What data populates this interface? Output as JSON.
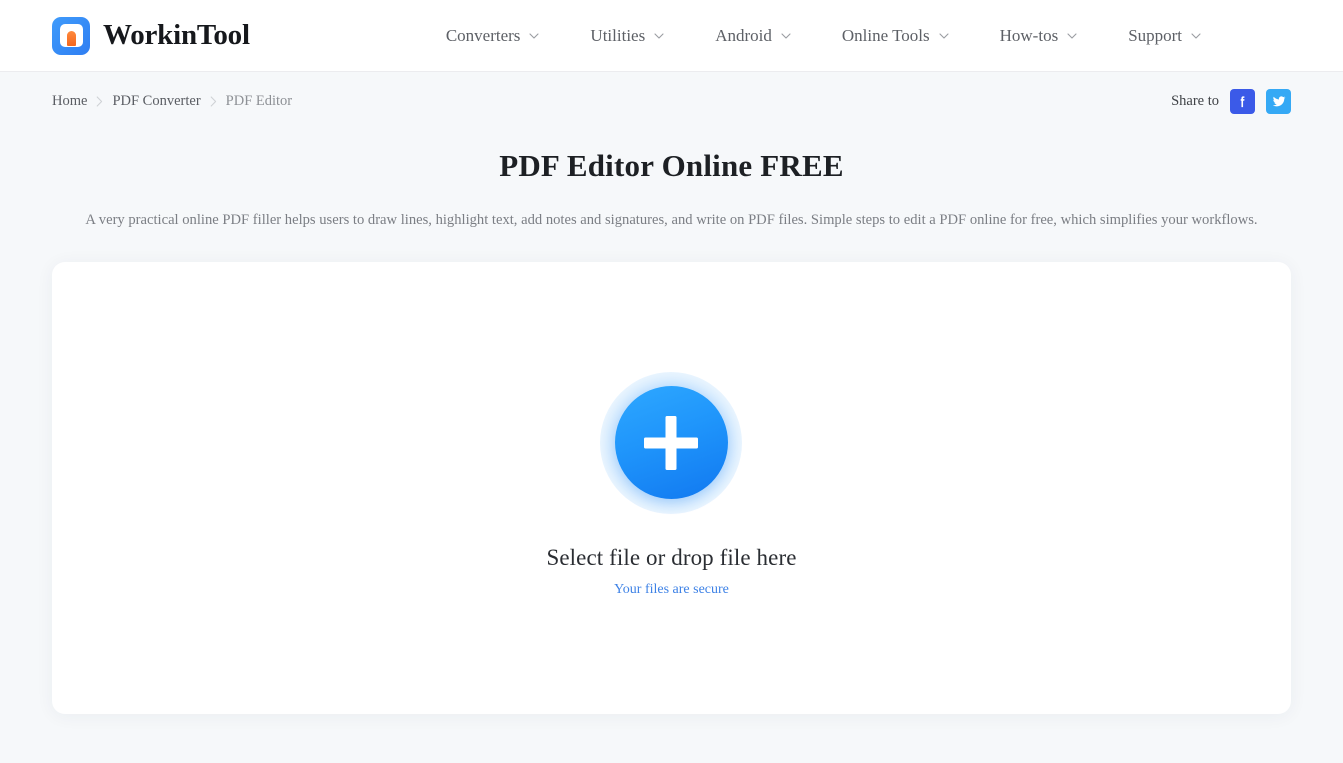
{
  "header": {
    "brand_name": "WorkinTool",
    "logo_icon": "workintool-logo-icon",
    "nav": [
      {
        "label": "Converters",
        "icon": "chevron-down-icon"
      },
      {
        "label": "Utilities",
        "icon": "chevron-down-icon"
      },
      {
        "label": "Android",
        "icon": "chevron-down-icon"
      },
      {
        "label": "Online Tools",
        "icon": "chevron-down-icon"
      },
      {
        "label": "How-tos",
        "icon": "chevron-down-icon"
      },
      {
        "label": "Support",
        "icon": "chevron-down-icon"
      }
    ]
  },
  "breadcrumb": {
    "separator_icon": "chevron-right-icon",
    "items": [
      {
        "label": "Home",
        "current": false
      },
      {
        "label": "PDF Converter",
        "current": false
      },
      {
        "label": "PDF Editor",
        "current": true
      }
    ]
  },
  "share": {
    "label": "Share to",
    "buttons": [
      {
        "name": "facebook-share-button",
        "icon": "facebook-icon",
        "color": "#3b5ae8"
      },
      {
        "name": "twitter-share-button",
        "icon": "twitter-icon",
        "color": "#35a9f5"
      }
    ]
  },
  "hero": {
    "title": "PDF Editor Online FREE",
    "subtitle": "A very practical online PDF filler helps users to draw lines, highlight text, add notes and signatures, and write on PDF files. Simple steps to edit a PDF online for free, which simplifies your workflows."
  },
  "upload": {
    "plus_icon": "plus-icon",
    "title": "Select file or drop file here",
    "secure_text": "Your files are secure"
  },
  "colors": {
    "page_background": "#f6f8fa",
    "header_background": "#ffffff",
    "card_background": "#ffffff",
    "accent_blue": "#1f95fb",
    "link_blue": "#3e82e6",
    "facebook_blue": "#3b5ae8",
    "twitter_blue": "#35a9f5",
    "logo_orange": "#f4661d"
  }
}
